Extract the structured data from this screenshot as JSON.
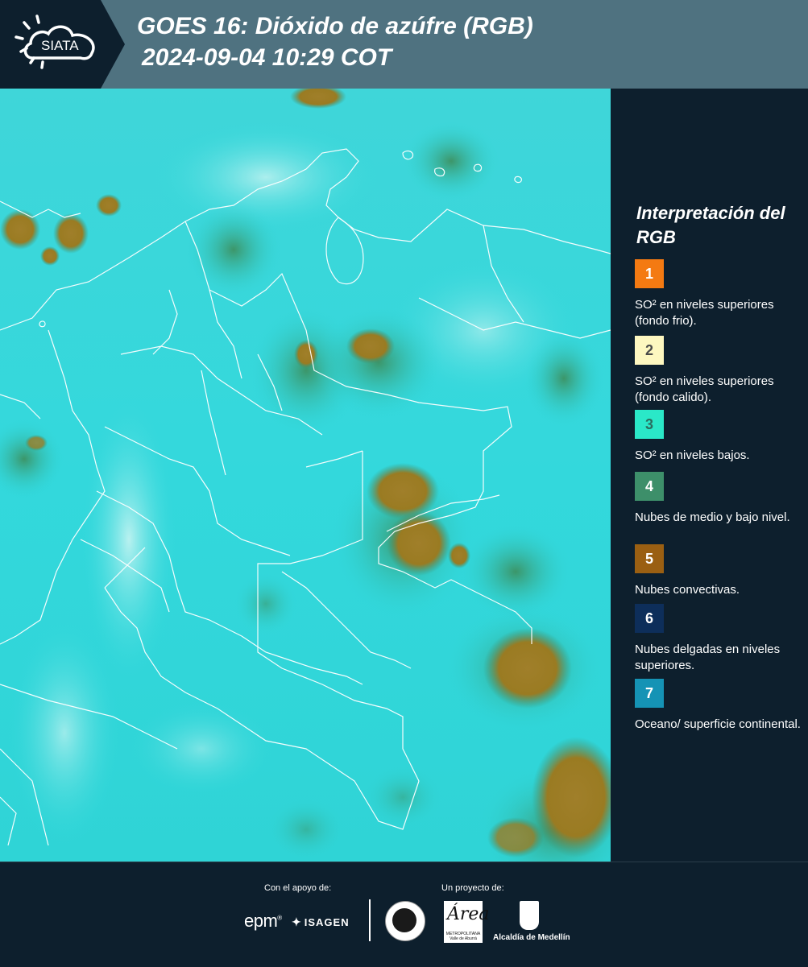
{
  "header": {
    "logo_text": "SIATA",
    "title": "GOES 16: Dióxido de azúfre (RGB)",
    "subtitle": "2024-09-04 10:29 COT"
  },
  "legend": {
    "title": "Interpretación del RGB",
    "items": [
      {
        "number": "1",
        "label": "SO² en niveles superiores (fondo frio).",
        "color": "#f47a12"
      },
      {
        "number": "2",
        "label": "SO² en niveles superiores (fondo calido).",
        "color": "#fdf7c0"
      },
      {
        "number": "3",
        "label": "SO² en niveles bajos.",
        "color": "#2ae8c8"
      },
      {
        "number": "4",
        "label": "Nubes de medio y bajo nivel.",
        "color": "#3d8f6a"
      },
      {
        "number": "5",
        "label": "Nubes convectivas.",
        "color": "#9a5f12"
      },
      {
        "number": "6",
        "label": "Nubes delgadas en niveles superiores.",
        "color": "#0d2e5a"
      },
      {
        "number": "7",
        "label": "Oceano/ superficie continental.",
        "color": "#1593b5"
      }
    ]
  },
  "footer": {
    "support_label": "Con el apoyo de:",
    "project_label": "Un proyecto de:",
    "epm": "epm",
    "isagen": "ISAGEN",
    "area_name": "Área",
    "area_sub": "METROPOLITANA Valle de Aburrá",
    "alcaldia": "Alcaldía de Medellín"
  }
}
